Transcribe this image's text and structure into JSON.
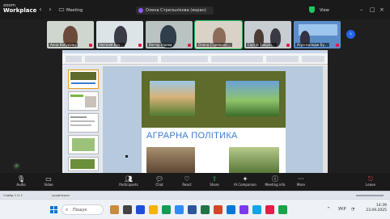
{
  "topbar": {
    "brand_top": "zoom",
    "brand_bottom": "Workplace",
    "meeting_label": "Meeting",
    "title": "Олена Стрельнікова (екран)",
    "view_label": "View"
  },
  "participants": [
    {
      "name": "Анна Кабудзан"
    },
    {
      "name": "Наталія Кру..."
    },
    {
      "name": "Віктор Ілалев"
    },
    {
      "name": "Олена Стрельнік..."
    },
    {
      "name": "Сергій Закірін..."
    },
    {
      "name": "Агро-коледж Бу..."
    }
  ],
  "slide": {
    "heading": "АГРАРНА ПОЛІТИКА"
  },
  "toolbar": {
    "audio": "Audio",
    "video": "Video",
    "participants": "Participants",
    "participants_count": "18",
    "chat": "Chat",
    "react": "React",
    "share": "Share",
    "ai_companion": "AI Companion",
    "meeting_info": "Meeting info",
    "more": "More",
    "leave": "Leave"
  },
  "ppt_status": {
    "slide_info": "Слайд 1 із 1",
    "lang": "українська"
  },
  "taskbar": {
    "search_placeholder": "Пошук",
    "time": "14:39",
    "date": "23.09.2025",
    "lang": "УКР"
  },
  "colors": {
    "zoom_bg": "#1a1a1a",
    "share_green": "#22c55e",
    "leave_red": "#ef4444",
    "slide_title_blue": "#3a7bd5",
    "slide_banner_olive": "#5e6b2a"
  }
}
